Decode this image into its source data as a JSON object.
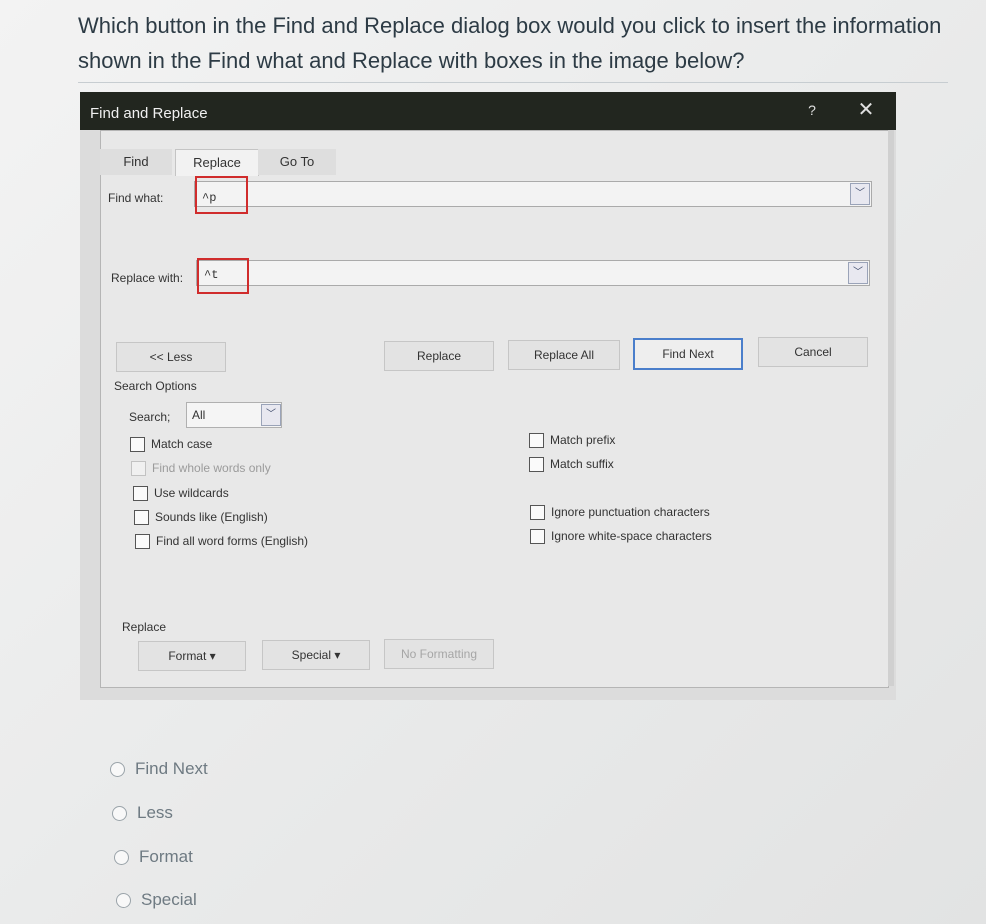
{
  "question": {
    "text": "Which button in the Find and Replace dialog box would you click to insert the information shown in the Find what and Replace with boxes in the image below?"
  },
  "dialog": {
    "title": "Find and Replace",
    "help_label": "?",
    "close_label": "✕",
    "tabs": [
      {
        "label": "Find"
      },
      {
        "label": "Replace"
      },
      {
        "label": "Go To"
      }
    ],
    "find_what": {
      "label": "Find what:",
      "value": "^p"
    },
    "replace_with": {
      "label": "Replace with:",
      "value": "^t"
    },
    "buttons": {
      "less": "<< Less",
      "replace": "Replace",
      "replace_all": "Replace All",
      "find_next": "Find Next",
      "cancel": "Cancel"
    },
    "search_options": {
      "heading": "Search Options",
      "search_label": "Search;",
      "search_value": "All",
      "left_checks": [
        {
          "label": "Match case",
          "enabled": true
        },
        {
          "label": "Find whole words only",
          "enabled": false
        },
        {
          "label": "Use wildcards",
          "enabled": true
        },
        {
          "label": "Sounds like (English)",
          "enabled": true
        },
        {
          "label": "Find all word forms (English)",
          "enabled": true
        }
      ],
      "right_checks": [
        {
          "label": "Match prefix"
        },
        {
          "label": "Match suffix"
        },
        {
          "label": "Ignore punctuation characters"
        },
        {
          "label": "Ignore white-space characters"
        }
      ]
    },
    "replace_section": {
      "heading": "Replace",
      "format_button": "Format ▾",
      "special_button": "Special ▾",
      "no_formatting_button": "No Formatting"
    }
  },
  "answers": [
    {
      "label": "Find Next"
    },
    {
      "label": "Less"
    },
    {
      "label": "Format"
    },
    {
      "label": "Special"
    }
  ]
}
